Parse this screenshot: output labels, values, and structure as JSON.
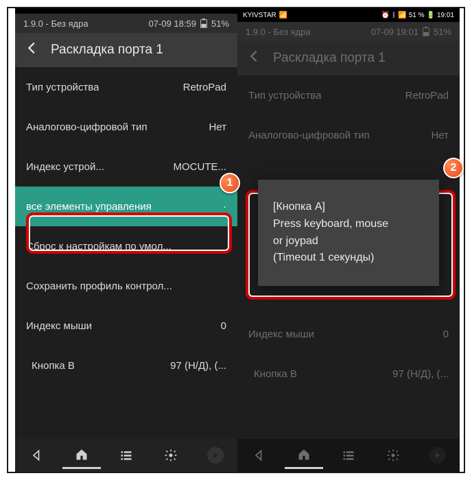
{
  "left": {
    "app_status": {
      "version": "1.9.0 - Без ядра",
      "time": "07-09 18:59",
      "battery_pct": "51%"
    },
    "header": {
      "title": "Раскладка порта 1"
    },
    "rows": [
      {
        "label": "Тип устройства",
        "value": "RetroPad"
      },
      {
        "label": "Аналогово-цифровой тип",
        "value": "Нет"
      },
      {
        "label": "Индекс устрой...",
        "value": "MOCUTE..."
      },
      {
        "label": "все элементы управления",
        "value": "·",
        "highlight": true
      },
      {
        "label": "Сброс к настройкам по умол...",
        "value": ""
      },
      {
        "label": "Сохранить профиль контрол...",
        "value": ""
      },
      {
        "label": "Индекс мыши",
        "value": "0"
      },
      {
        "label": "Кнопка B",
        "value": "97 (Н/Д), (..."
      }
    ]
  },
  "right": {
    "android_status": {
      "carrier": "KYIVSTAR",
      "indicators": "51 %",
      "time": "19:01"
    },
    "app_status": {
      "version": "1.9.0 - Без ядра",
      "time": "07-09 19:01",
      "battery_pct": "51%"
    },
    "header": {
      "title": "Раскладка порта 1"
    },
    "rows": [
      {
        "label": "Тип устройства",
        "value": "RetroPad"
      },
      {
        "label": "Аналогово-цифровой тип",
        "value": "Нет"
      },
      {
        "label": "",
        "value": ""
      },
      {
        "label": "",
        "value": ""
      },
      {
        "label": "",
        "value": ""
      },
      {
        "label": "",
        "value": ""
      },
      {
        "label": "Индекс мыши",
        "value": "0"
      },
      {
        "label": "Кнопка B",
        "value": "97 (Н/Д), (..."
      }
    ],
    "dialog": {
      "line1": "[Кнопка A]",
      "line2": "Press keyboard, mouse",
      "line3": "or joypad",
      "line4": "(Timeout 1 секунды)"
    }
  },
  "callouts": {
    "one": "1",
    "two": "2"
  }
}
